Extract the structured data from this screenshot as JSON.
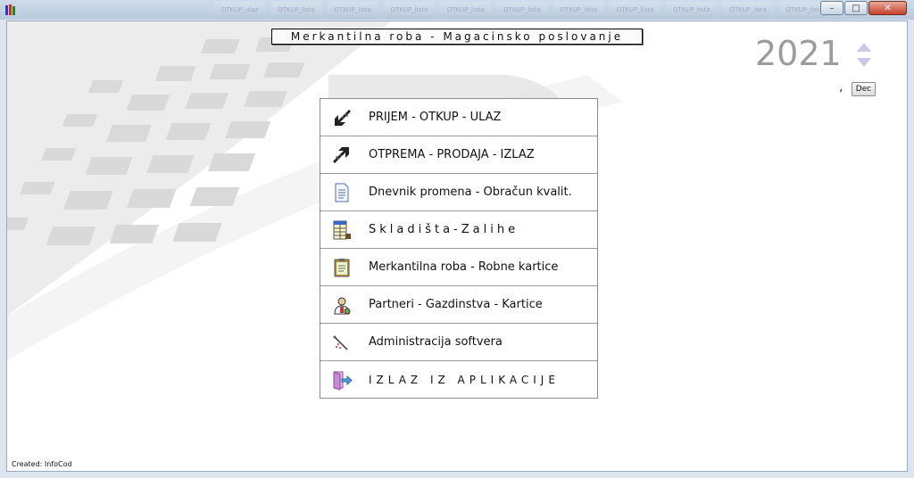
{
  "window": {
    "icon": "books-app-icon",
    "ghost_tabs": [
      "OTKUP_ulaz",
      "OTKUP_lista",
      "OTKUP_lista",
      "OTKUP_lista",
      "OTKUP_lista",
      "OTKUP_lista",
      "OTKUP_lista",
      "OTKUP_lista",
      "OTKUP_lista",
      "OTKUP_lista",
      "OTKUP_lista"
    ],
    "buttons": {
      "minimize": "–",
      "maximize": "□",
      "close": "✕"
    }
  },
  "header": {
    "title": "Merkantilna roba - Magacinsko poslovanje",
    "year": "2021",
    "comma": ",",
    "dec_button": "Dec"
  },
  "menu": [
    {
      "label": "PRIJEM - OTKUP - ULAZ",
      "icon": "incoming-arrow-icon"
    },
    {
      "label": "OTPREMA - PRODAJA - IZLAZ",
      "icon": "outgoing-arrow-icon"
    },
    {
      "label": "Dnevnik promena - Obračun kvalit.",
      "icon": "document-icon"
    },
    {
      "label": "Skladišta-Zalihe",
      "icon": "ledger-icon"
    },
    {
      "label": "Merkantilna roba - Robne kartice",
      "icon": "clipboard-icon"
    },
    {
      "label": "Partneri - Gazdinstva - Kartice",
      "icon": "person-icon"
    },
    {
      "label": "Administracija softvera",
      "icon": "tools-icon"
    },
    {
      "label": "IZLAZ IZ APLIKACIJE",
      "icon": "exit-door-icon"
    }
  ],
  "footer": {
    "created": "Created:  InfoCod"
  }
}
